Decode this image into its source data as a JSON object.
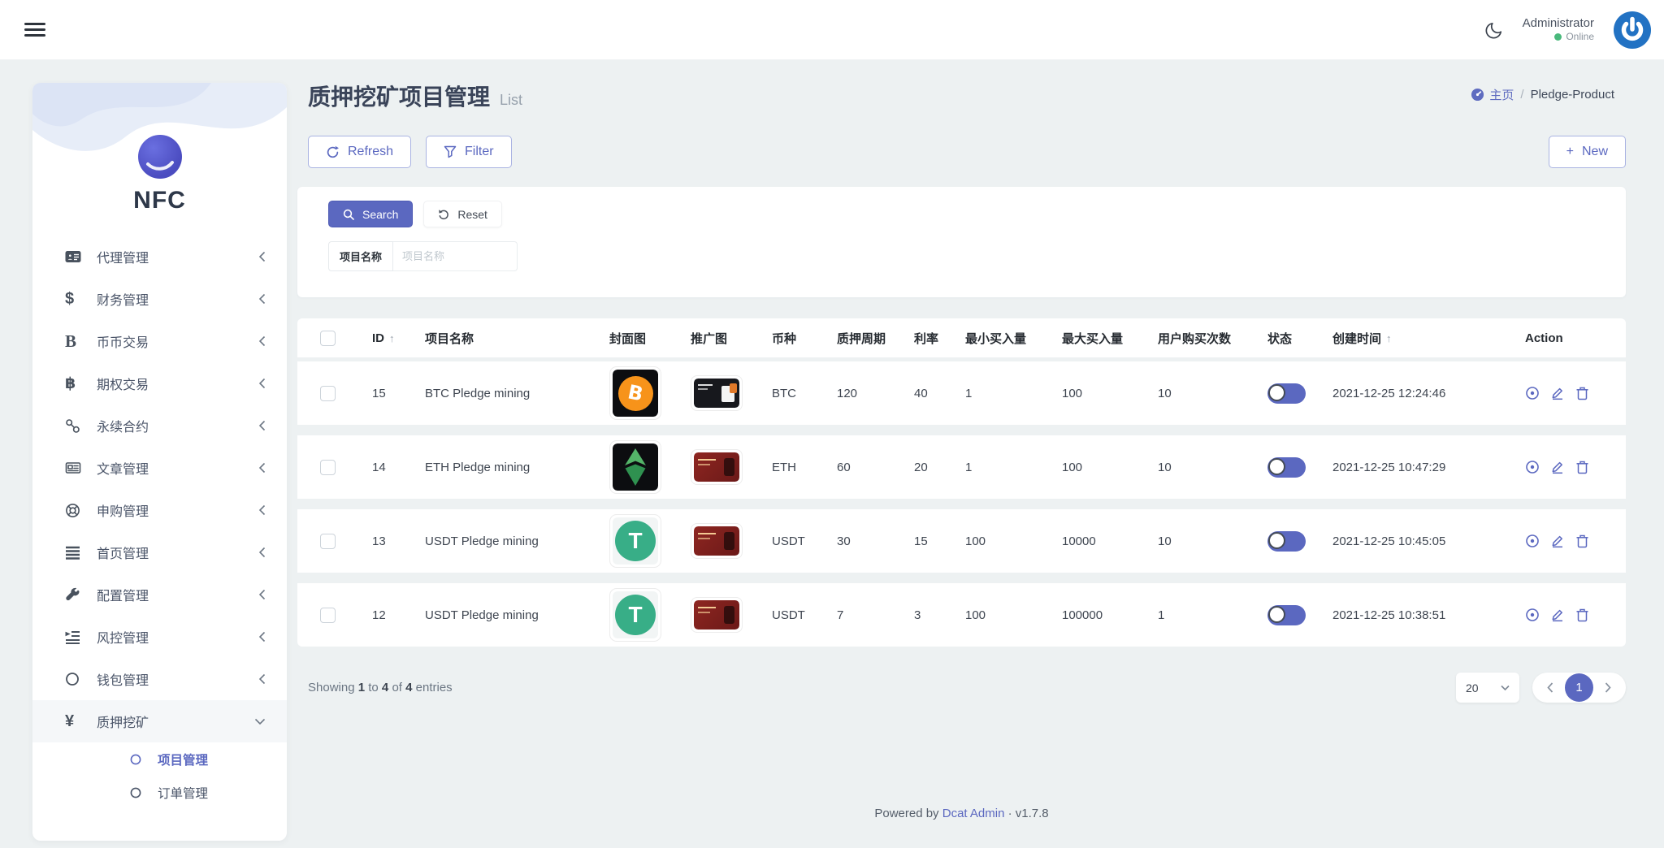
{
  "topbar": {
    "user_name": "Administrator",
    "user_status": "Online"
  },
  "sidebar": {
    "logo_text": "NFC",
    "items": [
      {
        "label": "代理管理",
        "icon": "id-card-icon",
        "chevron": "left"
      },
      {
        "label": "财务管理",
        "icon": "dollar-icon",
        "chevron": "left"
      },
      {
        "label": "币币交易",
        "icon": "coin-b-icon",
        "chevron": "left"
      },
      {
        "label": "期权交易",
        "icon": "bitcoin-icon",
        "chevron": "left"
      },
      {
        "label": "永续合约",
        "icon": "link-icon",
        "chevron": "left"
      },
      {
        "label": "文章管理",
        "icon": "newspaper-icon",
        "chevron": "left"
      },
      {
        "label": "申购管理",
        "icon": "life-ring-icon",
        "chevron": "left"
      },
      {
        "label": "首页管理",
        "icon": "bars-icon",
        "chevron": "left"
      },
      {
        "label": "配置管理",
        "icon": "wrench-icon",
        "chevron": "left"
      },
      {
        "label": "风控管理",
        "icon": "outdent-icon",
        "chevron": "left"
      },
      {
        "label": "钱包管理",
        "icon": "circle-icon",
        "chevron": "left"
      },
      {
        "label": "质押挖矿",
        "icon": "yen-icon",
        "chevron": "down",
        "active": true,
        "children": [
          {
            "label": "项目管理",
            "active": true
          },
          {
            "label": "订单管理"
          }
        ]
      }
    ]
  },
  "page_header": {
    "title": "质押挖矿项目管理",
    "subtitle": "List",
    "breadcrumb_home": "主页",
    "breadcrumb_sep": "/",
    "breadcrumb_current": "Pledge-Product"
  },
  "toolbar": {
    "refresh_label": "Refresh",
    "filter_label": "Filter",
    "new_label": "New",
    "plus": "+"
  },
  "filter_panel": {
    "search_label": "Search",
    "reset_label": "Reset",
    "field_label": "项目名称",
    "field_placeholder": "项目名称"
  },
  "table": {
    "columns": [
      {
        "key": "cb"
      },
      {
        "key": "id",
        "label": "ID",
        "sort": "asc"
      },
      {
        "key": "name",
        "label": "项目名称"
      },
      {
        "key": "cover",
        "label": "封面图"
      },
      {
        "key": "promo",
        "label": "推广图"
      },
      {
        "key": "coin",
        "label": "币种"
      },
      {
        "key": "period",
        "label": "质押周期"
      },
      {
        "key": "rate",
        "label": "利率"
      },
      {
        "key": "min_buy",
        "label": "最小买入量"
      },
      {
        "key": "max_buy",
        "label": "最大买入量"
      },
      {
        "key": "user_buys",
        "label": "用户购买次数"
      },
      {
        "key": "status",
        "label": "状态"
      },
      {
        "key": "created",
        "label": "创建时间",
        "sort": "asc"
      },
      {
        "key": "action",
        "label": "Action"
      }
    ],
    "rows": [
      {
        "id": "15",
        "name": "BTC Pledge mining",
        "cover": "btc-cover",
        "promo": "dark-promo",
        "coin": "BTC",
        "period": "120",
        "rate": "40",
        "min_buy": "1",
        "max_buy": "100",
        "user_buys": "10",
        "status_on": true,
        "created": "2021-12-25 12:24:46"
      },
      {
        "id": "14",
        "name": "ETH Pledge mining",
        "cover": "etc-cover",
        "promo": "red-promo",
        "coin": "ETH",
        "period": "60",
        "rate": "20",
        "min_buy": "1",
        "max_buy": "100",
        "user_buys": "10",
        "status_on": true,
        "created": "2021-12-25 10:47:29"
      },
      {
        "id": "13",
        "name": "USDT Pledge mining",
        "cover": "usdt-cover",
        "promo": "red-promo",
        "coin": "USDT",
        "period": "30",
        "rate": "15",
        "min_buy": "100",
        "max_buy": "10000",
        "user_buys": "10",
        "status_on": true,
        "created": "2021-12-25 10:45:05"
      },
      {
        "id": "12",
        "name": "USDT Pledge mining",
        "cover": "usdt-cover",
        "promo": "red-promo",
        "coin": "USDT",
        "period": "7",
        "rate": "3",
        "min_buy": "100",
        "max_buy": "100000",
        "user_buys": "1",
        "status_on": true,
        "created": "2021-12-25 10:38:51"
      }
    ]
  },
  "summary": {
    "showing_label": "Showing",
    "from": "1",
    "to_label": "to",
    "to": "4",
    "of_label": "of",
    "total": "4",
    "entries_label": "entries"
  },
  "pagination": {
    "page_size": "20",
    "current": "1"
  },
  "footer": {
    "powered_prefix": "Powered by",
    "brand": "Dcat Admin",
    "dot": "·",
    "version": "v1.7.8"
  },
  "colors": {
    "primary": "#5b68c0",
    "online_green": "#49b97c",
    "btc_orange": "#f7931a",
    "usdt_teal": "#38ae87"
  }
}
